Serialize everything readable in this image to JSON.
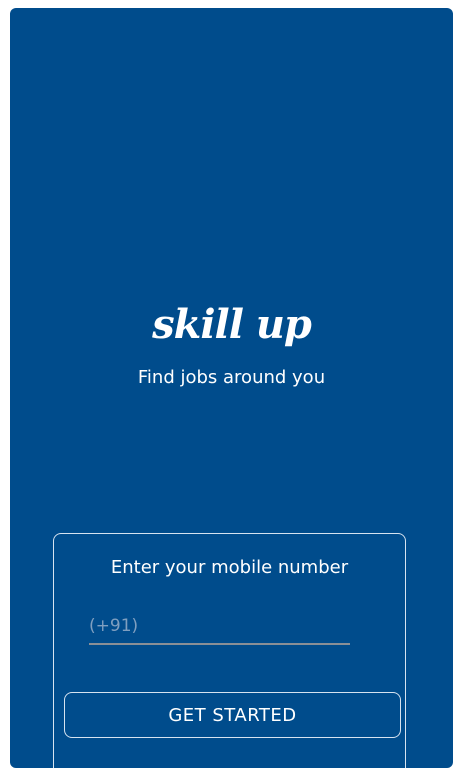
{
  "app": {
    "logo_text": "skill up",
    "tagline": "Find jobs around you"
  },
  "login_card": {
    "title": "Enter your mobile number",
    "phone_placeholder": "(+91)",
    "phone_value": "",
    "button_label": "GET STARTED"
  },
  "colors": {
    "background": "#004c8c",
    "text": "#ffffff",
    "border": "#d6e3f0",
    "input_underline": "#8a8f96"
  }
}
